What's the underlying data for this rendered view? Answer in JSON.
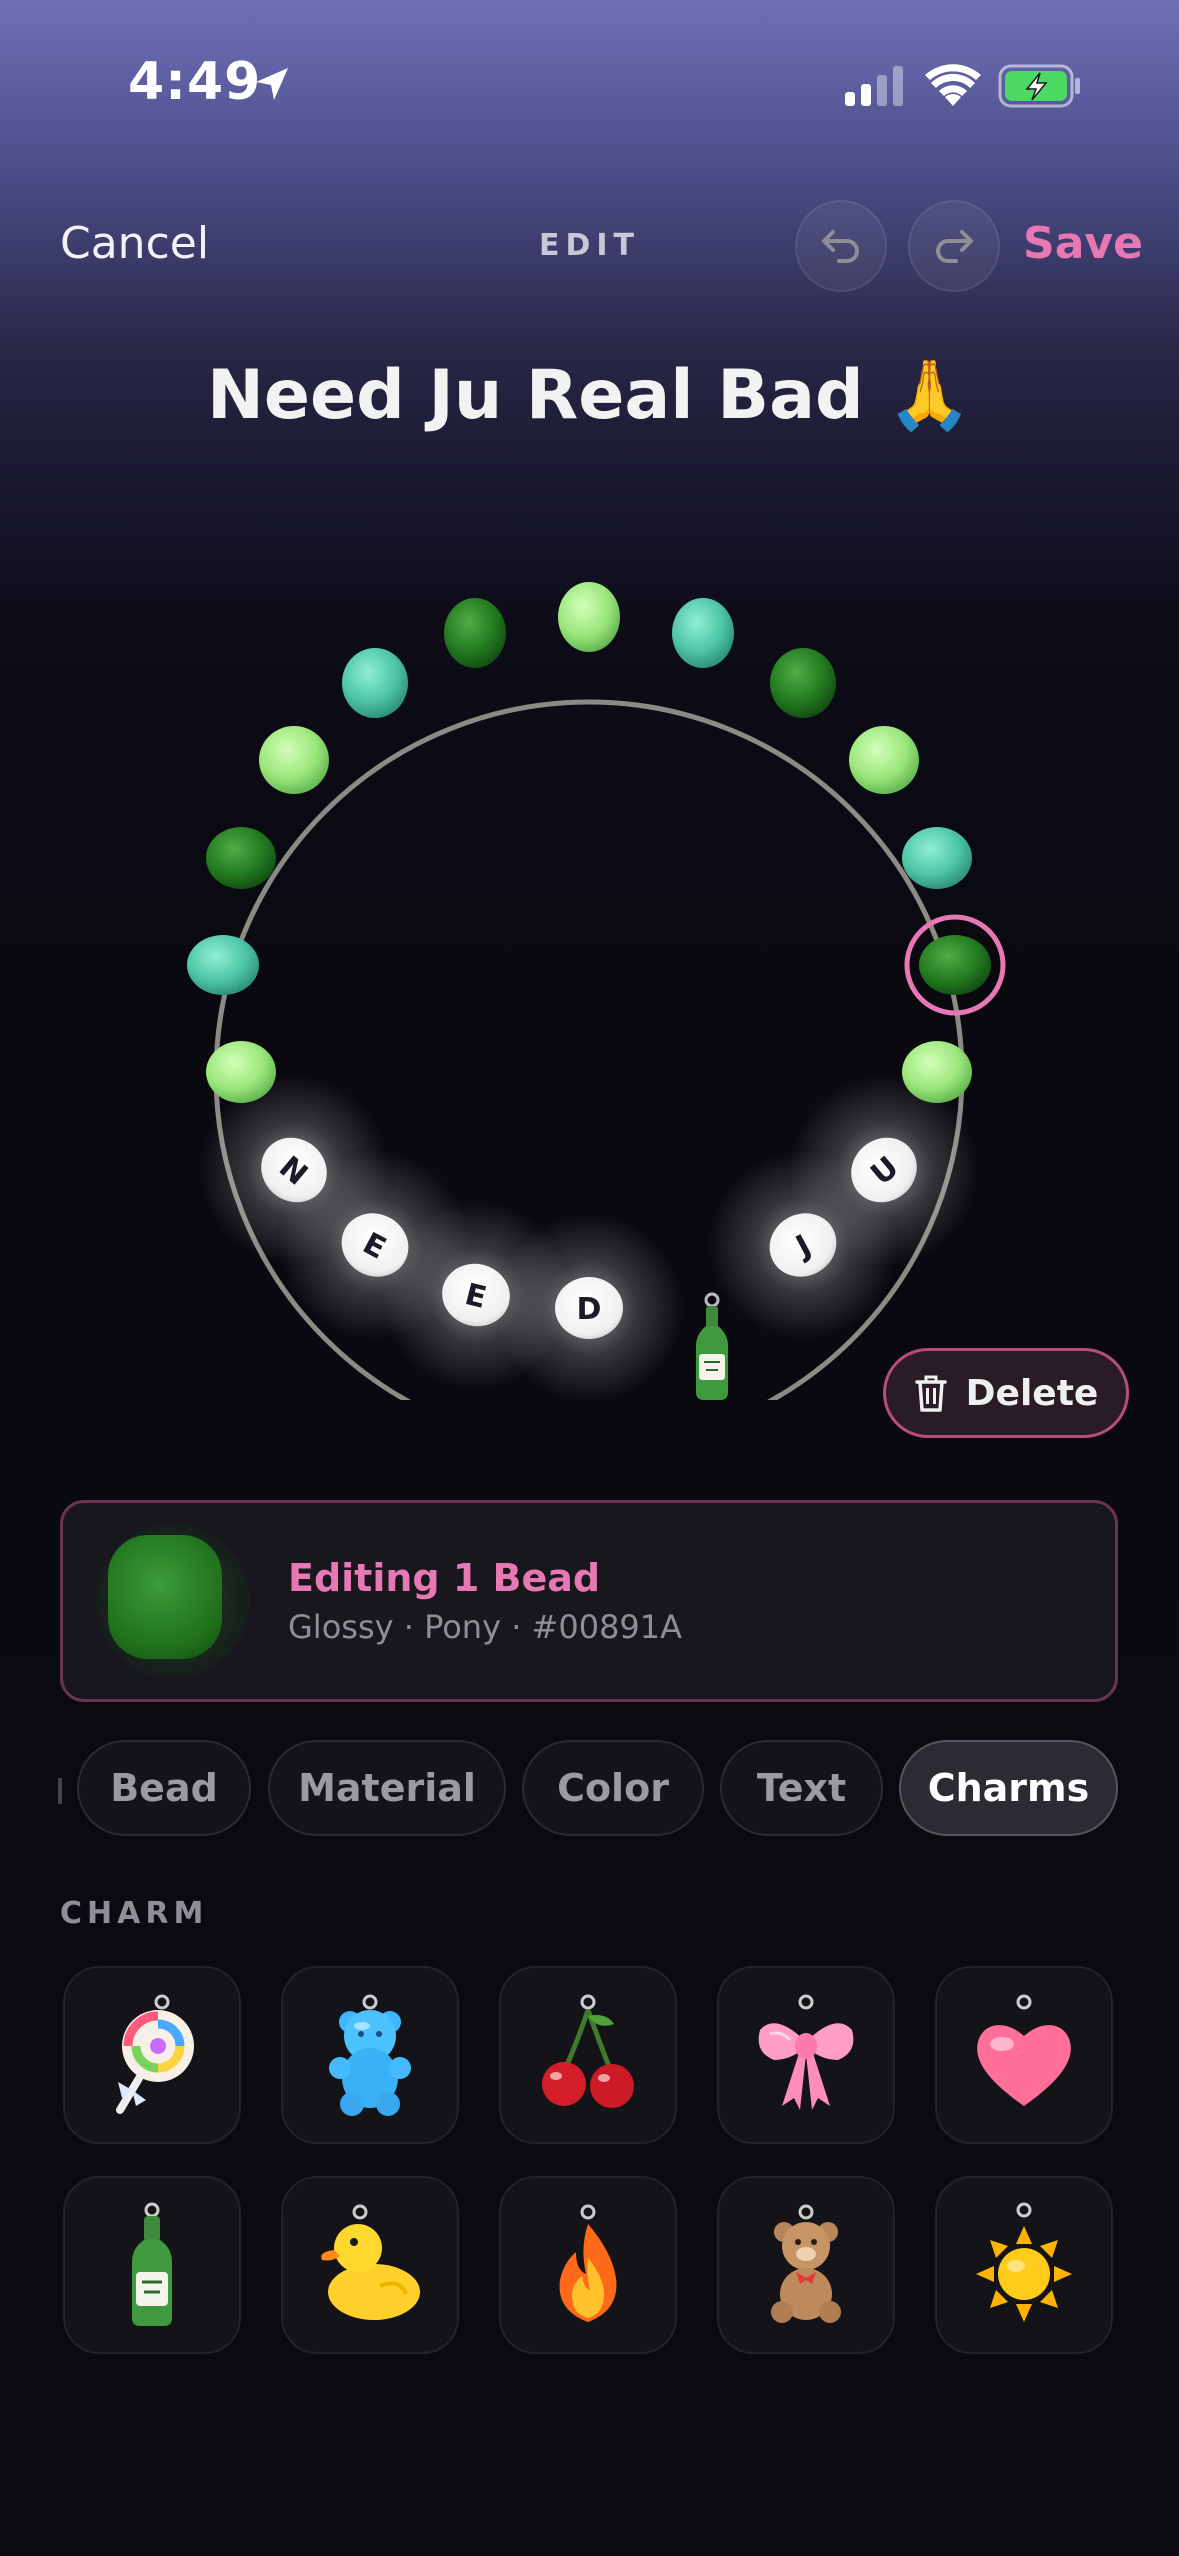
{
  "status_bar": {
    "time": "4:49"
  },
  "nav": {
    "cancel_label": "Cancel",
    "edit_label": "EDIT",
    "save_label": "Save"
  },
  "bracelet": {
    "name": "Need Ju Real Bad 🙏",
    "letters": [
      "N",
      "E",
      "E",
      "D",
      "J",
      "U"
    ]
  },
  "delete_label": "Delete",
  "editing_card": {
    "title": "Editing 1 Bead",
    "subtitle": "Glossy · Pony · #00891A"
  },
  "tabs": [
    {
      "label": "Bead",
      "active": false
    },
    {
      "label": "Material",
      "active": false
    },
    {
      "label": "Color",
      "active": false
    },
    {
      "label": "Text",
      "active": false
    },
    {
      "label": "Charms",
      "active": true
    }
  ],
  "charm_section": {
    "label": "CHARM",
    "charms": [
      "lollipop",
      "gummy-bear",
      "cherries",
      "bow",
      "heart",
      "soju-bottle",
      "rubber-duck",
      "flame",
      "teddy-bear",
      "sun"
    ]
  },
  "colors": {
    "accent": "#e878b4",
    "selected_bead": "#00891A"
  }
}
